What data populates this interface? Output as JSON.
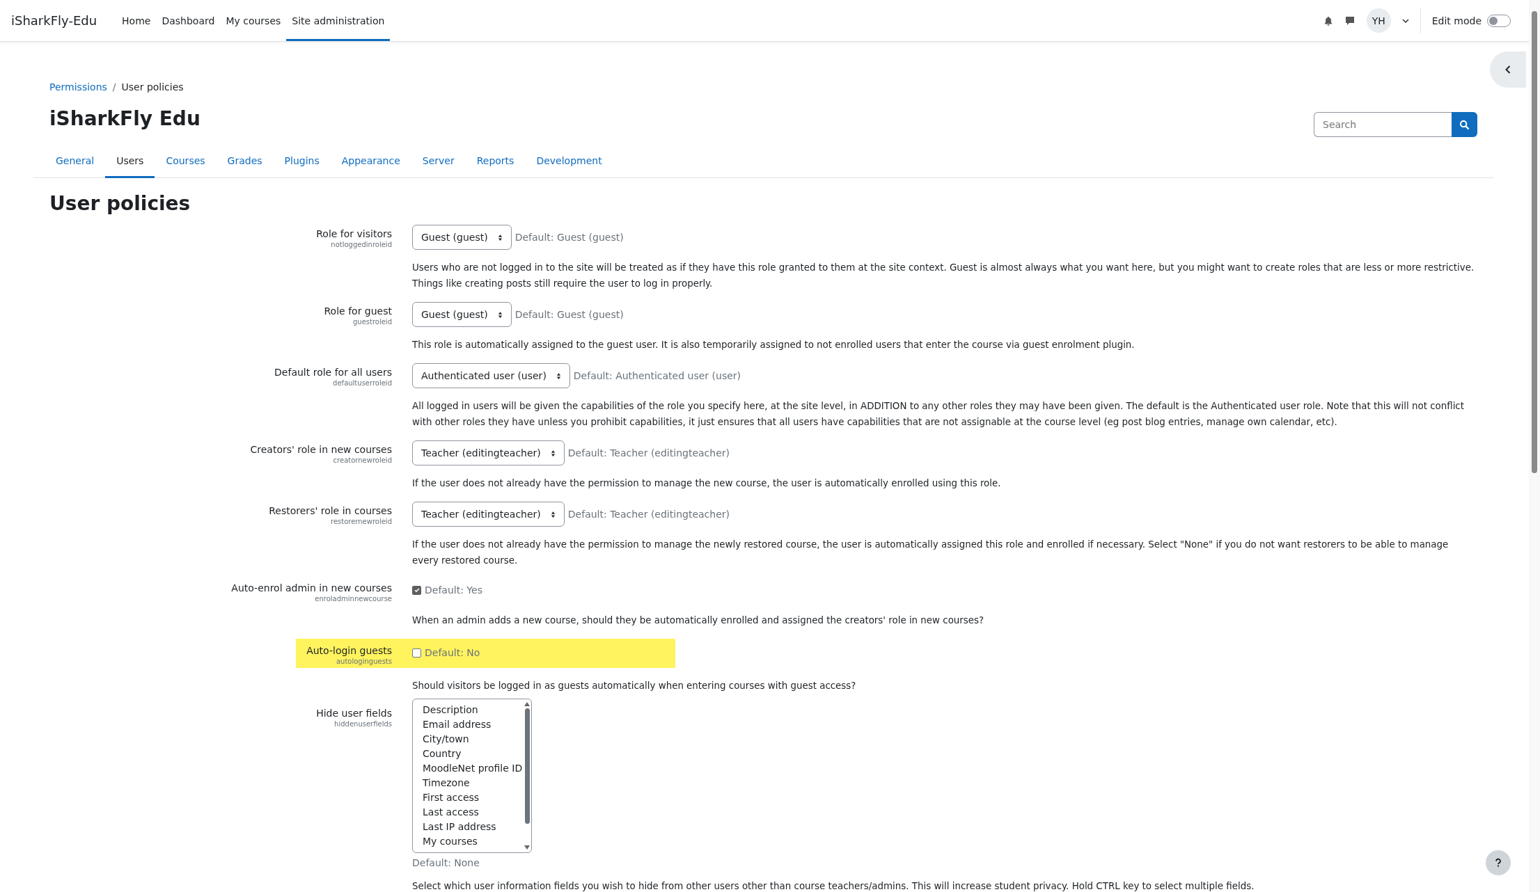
{
  "navbar": {
    "brand": "iSharkFly-Edu",
    "links": [
      {
        "label": "Home",
        "selected": false
      },
      {
        "label": "Dashboard",
        "selected": false
      },
      {
        "label": "My courses",
        "selected": false
      },
      {
        "label": "Site administration",
        "selected": true
      }
    ],
    "avatar": "YH",
    "edit_mode": {
      "label": "Edit mode",
      "on": false
    }
  },
  "breadcrumb_separator": "/",
  "breadcrumb": [
    {
      "label": "Permissions",
      "kind": "link"
    },
    {
      "label": "User policies",
      "kind": "current"
    }
  ],
  "page_title": "iSharkFly Edu",
  "search": {
    "placeholder": "Search"
  },
  "tabs": [
    {
      "label": "General",
      "selected": false
    },
    {
      "label": "Users",
      "selected": true
    },
    {
      "label": "Courses",
      "selected": false
    },
    {
      "label": "Grades",
      "selected": false
    },
    {
      "label": "Plugins",
      "selected": false
    },
    {
      "label": "Appearance",
      "selected": false
    },
    {
      "label": "Server",
      "selected": false
    },
    {
      "label": "Reports",
      "selected": false
    },
    {
      "label": "Development",
      "selected": false
    }
  ],
  "heading": "User policies",
  "settings": [
    {
      "kind": "select",
      "label": "Role for visitors",
      "name": "notloggedinroleid",
      "value": "Guest (guest)",
      "default": "Default: Guest (guest)",
      "highlighted": false,
      "description": "Users who are not logged in to the site will be treated as if they have this role granted to them at the site context. Guest is almost always what you want here, but you might want to create roles that are less or more restrictive. Things like creating posts still require the user to log in properly."
    },
    {
      "kind": "select",
      "label": "Role for guest",
      "name": "guestroleid",
      "value": "Guest (guest)",
      "default": "Default: Guest (guest)",
      "highlighted": false,
      "description": "This role is automatically assigned to the guest user. It is also temporarily assigned to not enrolled users that enter the course via guest enrolment plugin."
    },
    {
      "kind": "select",
      "label": "Default role for all users",
      "name": "defaultuserroleid",
      "value": "Authenticated user (user)",
      "default": "Default: Authenticated user (user)",
      "highlighted": false,
      "description": "All logged in users will be given the capabilities of the role you specify here, at the site level, in ADDITION to any other roles they may have been given. The default is the Authenticated user role. Note that this will not conflict with other roles they have unless you prohibit capabilities, it just ensures that all users have capabilities that are not assignable at the course level (eg post blog entries, manage own calendar, etc)."
    },
    {
      "kind": "select",
      "label": "Creators' role in new courses",
      "name": "creatornewroleid",
      "value": "Teacher (editingteacher)",
      "default": "Default: Teacher (editingteacher)",
      "highlighted": false,
      "description": "If the user does not already have the permission to manage the new course, the user is automatically enrolled using this role."
    },
    {
      "kind": "select",
      "label": "Restorers' role in courses",
      "name": "restorernewroleid",
      "value": "Teacher (editingteacher)",
      "default": "Default: Teacher (editingteacher)",
      "highlighted": false,
      "description": "If the user does not already have the permission to manage the newly restored course, the user is automatically assigned this role and enrolled if necessary. Select \"None\" if you do not want restorers to be able to manage every restored course."
    },
    {
      "kind": "checkbox",
      "label": "Auto-enrol admin in new courses",
      "name": "enroladminnewcourse",
      "checked": true,
      "default": "Default: Yes",
      "highlighted": false,
      "description": "When an admin adds a new course, should they be automatically enrolled and assigned the creators' role in new courses?"
    },
    {
      "kind": "checkbox",
      "label": "Auto-login guests",
      "name": "autologinguests",
      "checked": false,
      "default": "Default: No",
      "highlighted": true,
      "description": "Should visitors be logged in as guests automatically when entering courses with guest access?"
    },
    {
      "kind": "multiselect",
      "label": "Hide user fields",
      "name": "hiddenuserfields",
      "options": [
        "Description",
        "Email address",
        "City/town",
        "Country",
        "MoodleNet profile ID",
        "Timezone",
        "First access",
        "Last access",
        "Last IP address",
        "My courses"
      ],
      "default": "Default: None",
      "highlighted": false,
      "description": "Select which user information fields you wish to hide from other users other than course teachers/admins. This will increase student privacy. Hold CTRL key to select multiple fields."
    }
  ]
}
